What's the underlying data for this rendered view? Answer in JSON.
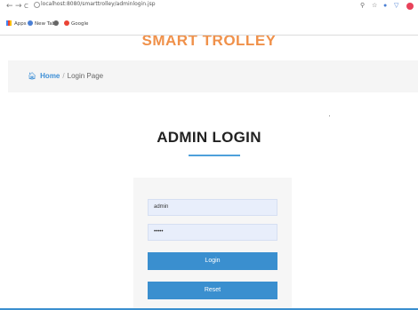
{
  "browser": {
    "nav": {
      "back": "←",
      "forward": "→",
      "reload": "C"
    },
    "url": "localhost:8080/smarttrolley/adminlogin.jsp",
    "bookmarks": [
      {
        "label": "Apps"
      },
      {
        "label": "New Tab"
      },
      {
        "label": ""
      },
      {
        "label": "Google"
      }
    ]
  },
  "site": {
    "title": "SMART TROLLEY"
  },
  "breadcrumb": {
    "home": "Home",
    "separator": "/",
    "current": "Login Page"
  },
  "login": {
    "title": "ADMIN LOGIN",
    "username_value": "admin",
    "password_value": "•••••",
    "login_label": "Login",
    "reset_label": "Reset"
  },
  "colors": {
    "title_accent": "#f0914a",
    "link_blue": "#3d8fd6",
    "button_blue": "#3a8fcf",
    "input_bg": "#e8eefb"
  }
}
